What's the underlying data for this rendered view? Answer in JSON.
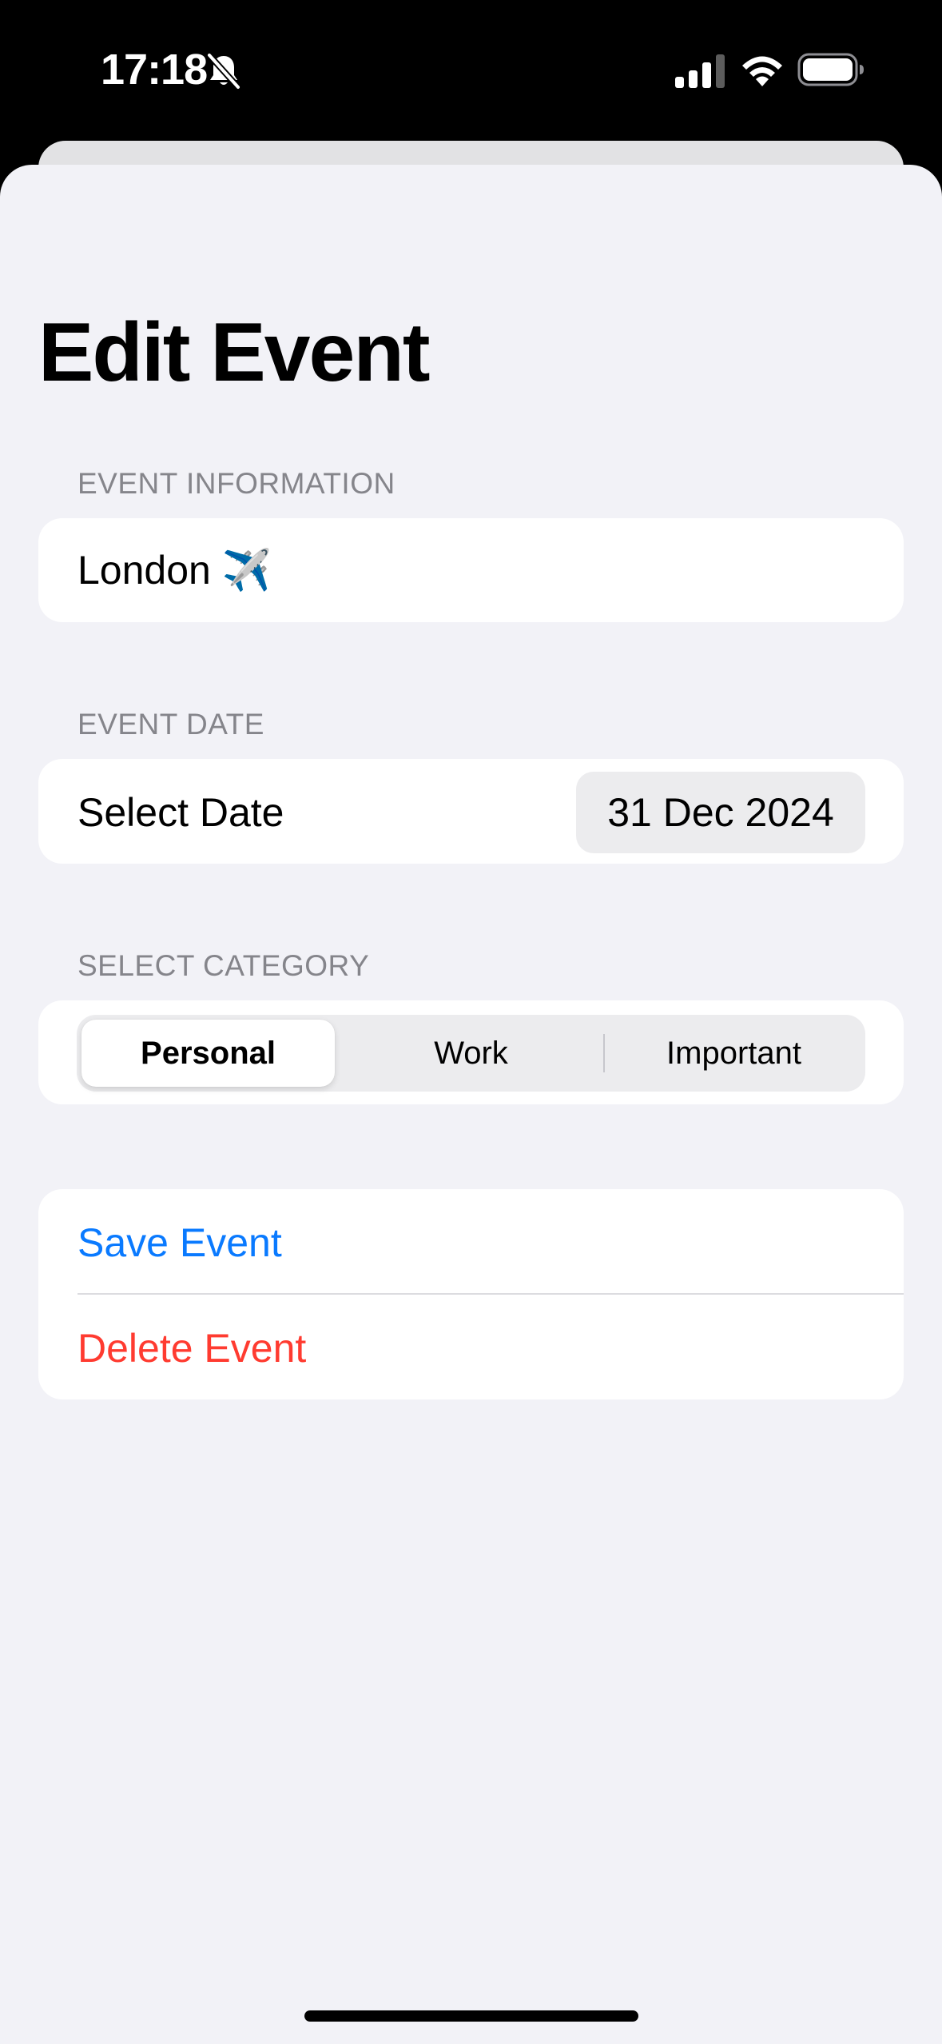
{
  "status_bar": {
    "time": "17:18",
    "icons": [
      "bell-slash-icon",
      "cellular-signal-icon",
      "wifi-icon",
      "battery-icon"
    ]
  },
  "page": {
    "title": "Edit Event"
  },
  "event_information": {
    "header": "EVENT INFORMATION",
    "name_value": "London ✈️"
  },
  "event_date": {
    "header": "EVENT DATE",
    "label": "Select Date",
    "value": "31 Dec 2024"
  },
  "category": {
    "header": "SELECT CATEGORY",
    "options": [
      "Personal",
      "Work",
      "Important"
    ],
    "selected": "Personal"
  },
  "actions": {
    "save_label": "Save Event",
    "delete_label": "Delete Event"
  },
  "colors": {
    "background": "#f2f2f7",
    "card": "#ffffff",
    "accent_blue": "#0a7aff",
    "destructive_red": "#ff3b30",
    "secondary_text": "#85858b"
  }
}
